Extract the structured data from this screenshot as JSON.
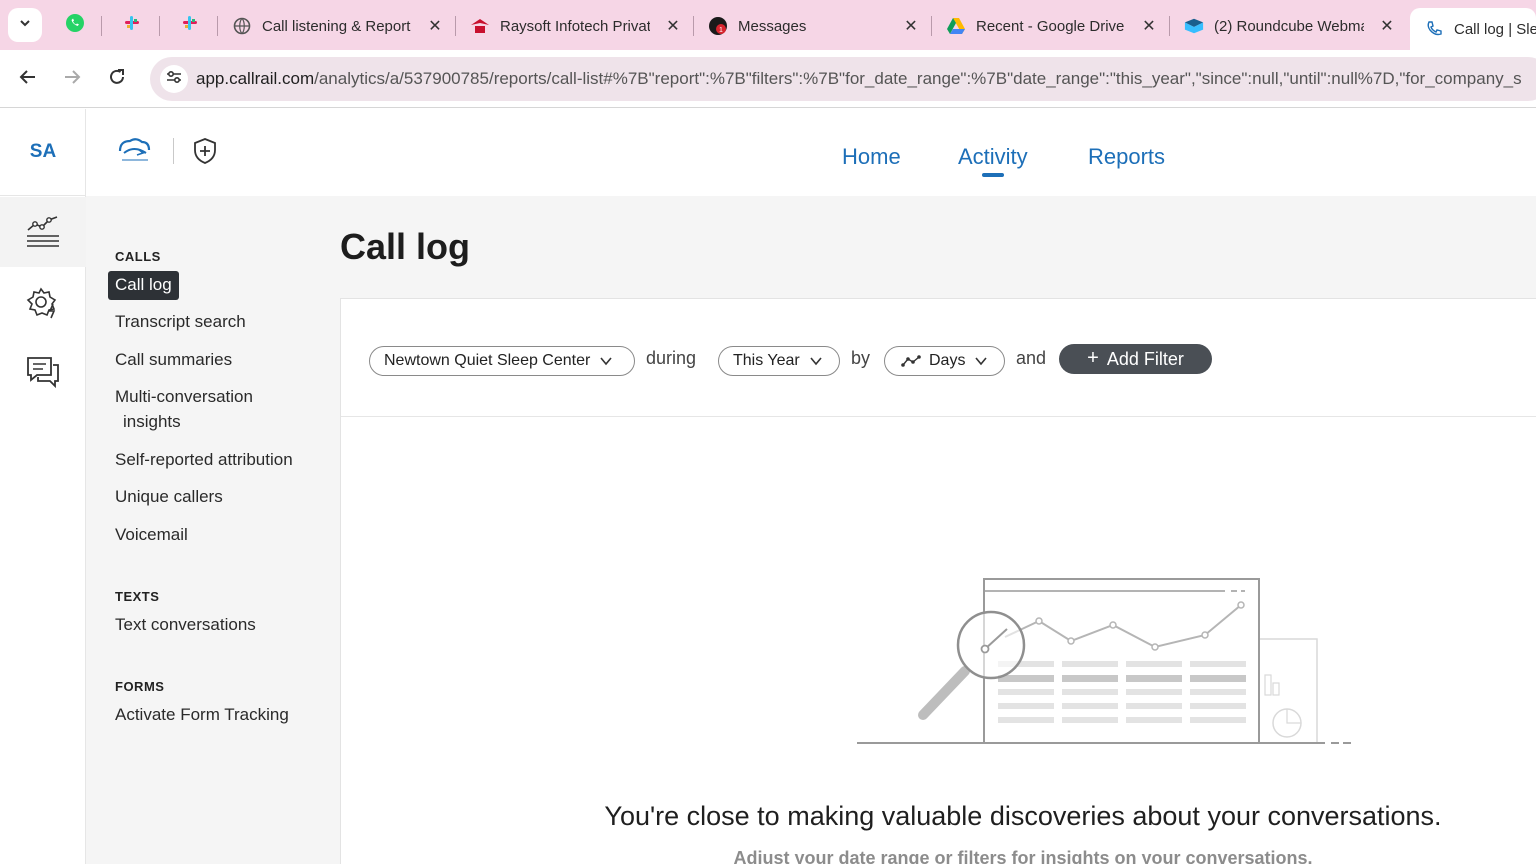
{
  "browser": {
    "tabs": [
      {
        "title": "Call listening & Report",
        "icon": "globe-icon"
      },
      {
        "title": "Raysoft Infotech Privat",
        "icon": "raysoft-icon"
      },
      {
        "title": "Messages",
        "icon": "messages-icon"
      },
      {
        "title": "Recent - Google Drive",
        "icon": "google-drive-icon"
      },
      {
        "title": "(2) Roundcube Webma",
        "icon": "roundcube-icon"
      },
      {
        "title": "Call log | Slee",
        "icon": "phone-icon"
      }
    ],
    "url_host": "app.callrail.com",
    "url_path": "/analytics/a/537900785/reports/call-list#%7B\"report\":%7B\"filters\":%7B\"for_date_range\":%7B\"date_range\":\"this_year\",\"since\":null,\"until\":null%7D,\"for_company_s"
  },
  "rail": {
    "avatar": "SA"
  },
  "topnav": {
    "links": [
      "Home",
      "Activity",
      "Reports"
    ],
    "active": "Activity"
  },
  "sidenav": {
    "calls_heading": "CALLS",
    "calls": [
      "Call log",
      "Transcript search",
      "Call summaries",
      "Multi-conversation",
      "insights",
      "Self-reported attribution",
      "Unique callers",
      "Voicemail"
    ],
    "texts_heading": "TEXTS",
    "texts": [
      "Text conversations"
    ],
    "forms_heading": "FORMS",
    "forms": [
      "Activate Form Tracking"
    ]
  },
  "page": {
    "title": "Call log"
  },
  "filters": {
    "company": "Newtown Quiet Sleep Center",
    "during": "during",
    "date_range": "This Year",
    "by": "by",
    "interval": "Days",
    "and": "and",
    "add_filter": "Add Filter"
  },
  "empty_state": {
    "title": "You're close to making valuable discoveries about your conversations.",
    "subtitle": "Adjust your date range or filters for insights on your conversations."
  },
  "colors": {
    "accent": "#1d6fb8",
    "tabbar": "#f6d6e6",
    "active_nav_bg": "#2d3136",
    "add_filter_bg": "#4a4f55"
  }
}
